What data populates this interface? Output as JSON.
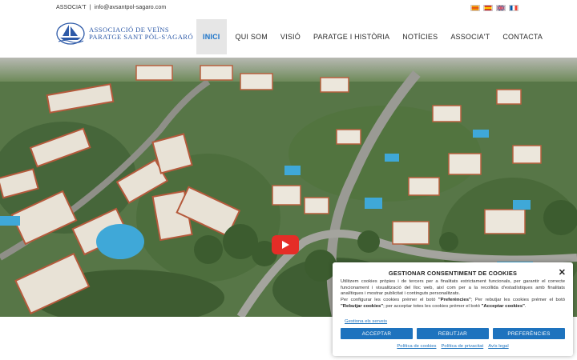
{
  "topbar": {
    "associat": "ASSOCIA'T",
    "separator": "|",
    "email": "info@avsantpol-sagaro.com",
    "flags": [
      "catalan-flag-icon",
      "spanish-flag-icon",
      "uk-flag-icon",
      "french-flag-icon"
    ]
  },
  "logo": {
    "line1": "ASSOCIACIÓ DE VEÏNS",
    "line2": "PARATGE SANT PÒL-S'AGARÓ",
    "icon": "sailboat-logo-icon"
  },
  "nav": {
    "items": [
      "INICI",
      "QUI SOM",
      "VISIÓ",
      "PARATGE I HISTÒRIA",
      "NOTÍCIES",
      "ASSOCIA'T",
      "CONTACTA"
    ],
    "active": "INICI"
  },
  "hero": {
    "play_icon": "youtube-play-icon"
  },
  "cookie": {
    "title": "GESTIONAR CONSENTIMENT DE COOKIES",
    "p1": "Utilitzem cookies pròpies i de tercers per a finalitats estrictament funcionals, per garantir el correcte funcionament i visualització del lloc web, així com per a la recollida d'estadístiques amb finalitats analítiques i mostrar publicitat i continguts personalitzats.",
    "p2_a": "Per configurar les cookies prémer el botó ",
    "p2_b": "\"Preferències\"",
    "p2_c": "; Per rebutjar les cookies prémer el botó ",
    "p2_d": "\"Rebutjar cookies\"",
    "p2_e": "; per acceptar totes les cookies prémer el botó ",
    "p2_f": "\"Acceptar cookies\"",
    "p2_g": ".",
    "manage": "Gestiona els serveis",
    "accept": "ACCEPTAR",
    "reject": "REBUTJAR",
    "preferences": "PREFERÈNCIES",
    "links": [
      "Política de cookies",
      "Política de privacitat",
      "Avís legal"
    ]
  },
  "colors": {
    "accent": "#1e73be",
    "active_nav_bg": "#e6e6e6",
    "logo_blue": "#2e5aa8",
    "play_red": "#e52d27"
  }
}
